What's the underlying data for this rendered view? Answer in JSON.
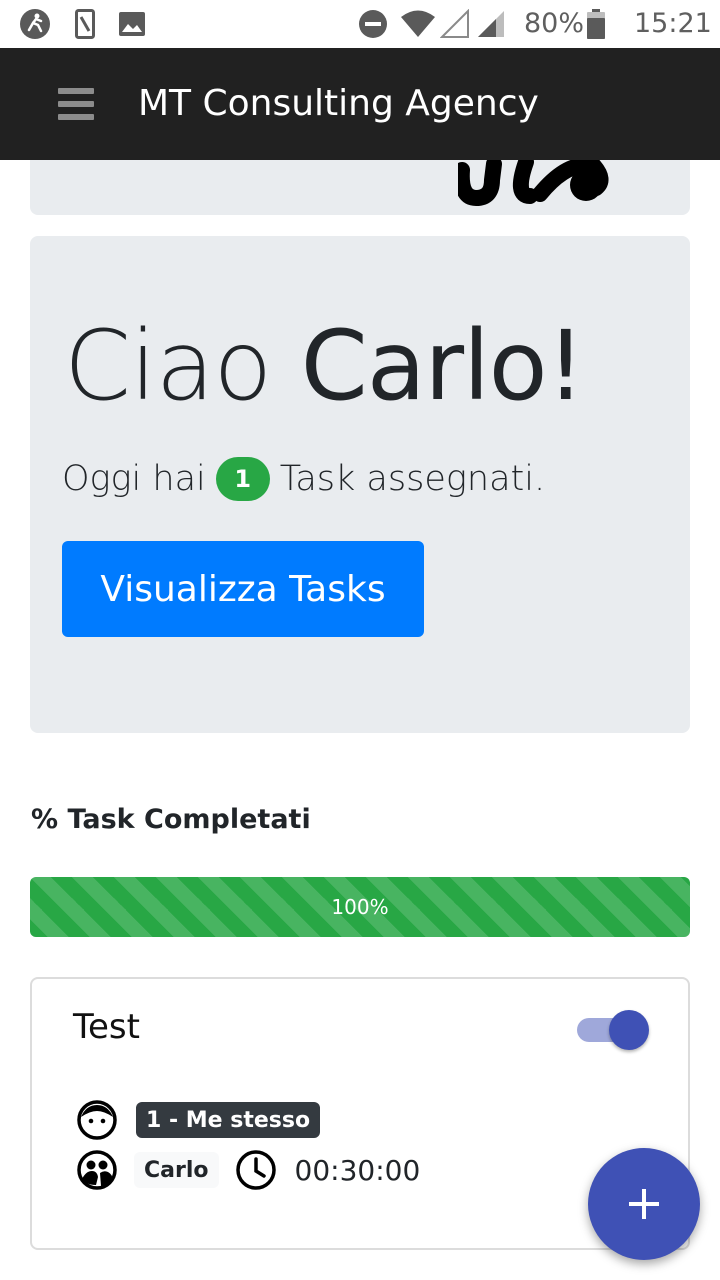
{
  "status_bar": {
    "battery": "80%",
    "time": "15:21",
    "icons": [
      "running-app-icon",
      "phone-sim-icon",
      "image-icon",
      "do-not-disturb-icon",
      "wifi-icon",
      "signal-empty-icon",
      "signal-icon",
      "battery-icon"
    ]
  },
  "app_bar": {
    "title": "MT Consulting Agency",
    "menu_icon": "hamburger-menu-icon"
  },
  "hero": {
    "greeting_prefix": "Ciao",
    "greeting_name": "Carlo!",
    "lead_prefix": "Oggi hai",
    "task_count": "1",
    "lead_suffix": "Task assegnati.",
    "button_label": "Visualizza Tasks"
  },
  "progress": {
    "title": "% Task Completati",
    "label": "100%",
    "value": 1.0
  },
  "task": {
    "title": "Test",
    "toggle_on": true,
    "assignee_badge": "1 - Me stesso",
    "owner": "Carlo",
    "duration": "00:30:00"
  },
  "fab": {
    "icon": "plus-icon"
  },
  "colors": {
    "app_bar": "#212121",
    "jumbotron": "#e9ecef",
    "primary": "#007bff",
    "success": "#28a745",
    "accent": "#3f51b5",
    "dark_badge": "#343a40"
  }
}
